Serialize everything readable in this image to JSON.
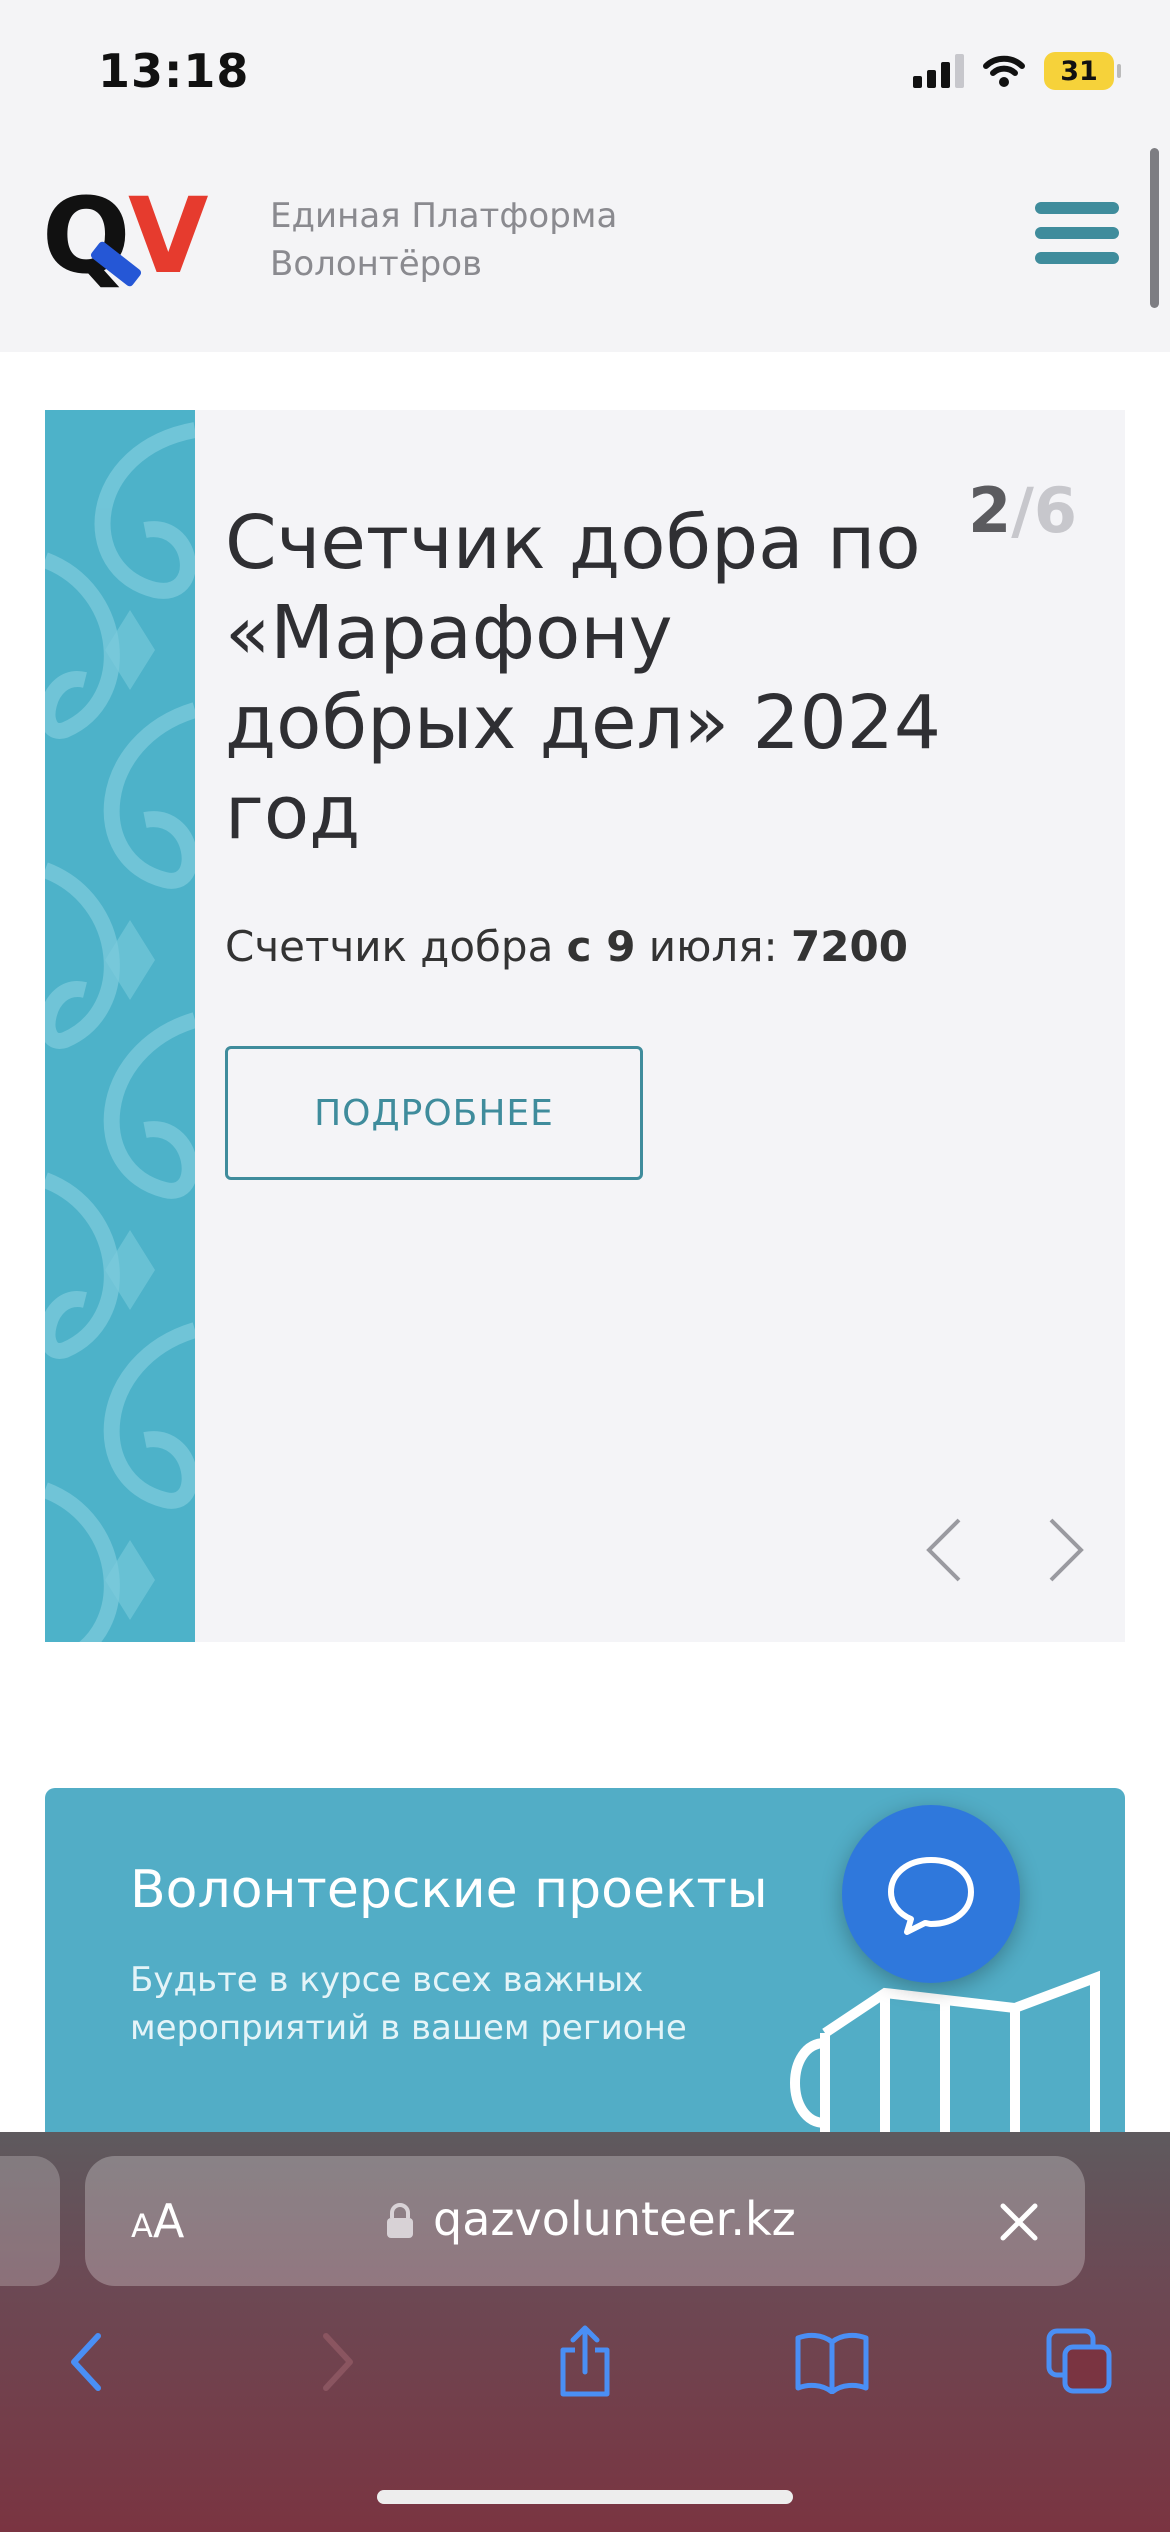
{
  "status_bar": {
    "time": "13:18",
    "battery": "31"
  },
  "header": {
    "logo_text": "QV",
    "tagline_line1": "Единая Платформа",
    "tagline_line2": "Волонтёров"
  },
  "hero": {
    "slide_current": "2",
    "slide_separator": "/",
    "slide_total": "6",
    "title": "Счетчик добра по «Марафону добрых дел» 2024 год",
    "subtitle_prefix": "Счетчик добра ",
    "subtitle_date": "с 9",
    "subtitle_middle": " июля: ",
    "subtitle_count": "7200",
    "button_label": "ПОДРОБНЕЕ"
  },
  "projects": {
    "title": "Волонтерские проекты",
    "description": "Будьте в курсе всех важных мероприятий в вашем регионе"
  },
  "browser": {
    "reader_small": "A",
    "reader_large": "A",
    "url": "qazvolunteer.kz"
  },
  "colors": {
    "accent": "#3f8c9c",
    "ornament": "#4db2c9",
    "projects_bg": "#52adc6",
    "chat": "#2f78dc",
    "logo_red": "#e63b2e",
    "logo_blue": "#2557d6"
  },
  "icons": [
    "menu-icon",
    "chevron-left-icon",
    "chevron-right-icon",
    "chat-bubble-icon",
    "megaphone-icon",
    "lock-icon",
    "close-icon",
    "back-icon",
    "forward-icon",
    "share-icon",
    "bookmarks-icon",
    "tabs-icon"
  ]
}
